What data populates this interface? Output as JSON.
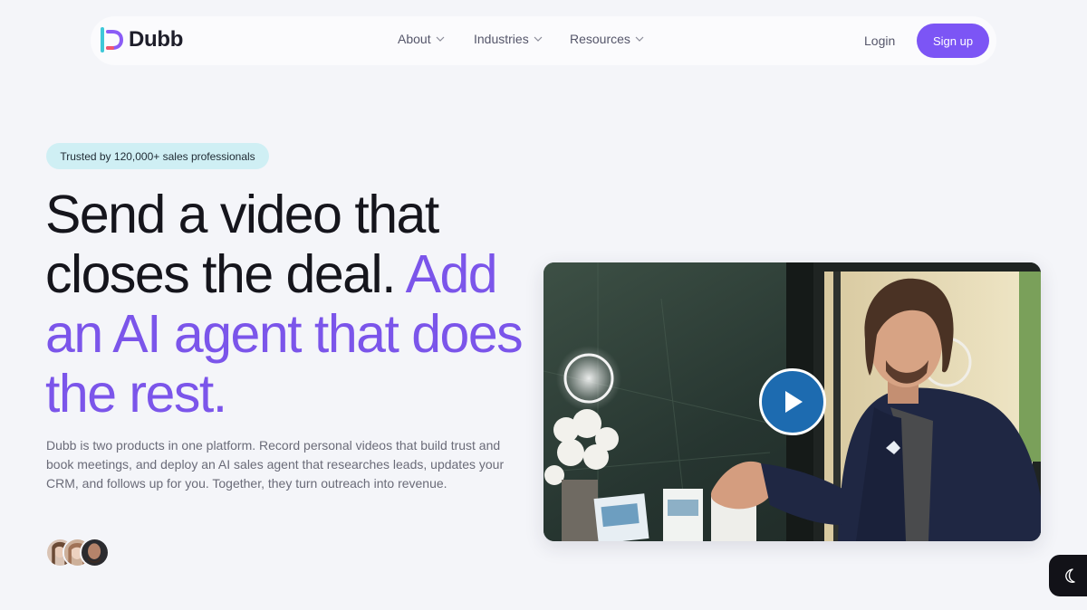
{
  "brand": {
    "name": "Dubb"
  },
  "nav": {
    "links": [
      {
        "label": "About"
      },
      {
        "label": "Industries"
      },
      {
        "label": "Resources"
      }
    ],
    "login_label": "Login",
    "signup_label": "Sign up"
  },
  "hero": {
    "badge": "Trusted by 120,000+ sales professionals",
    "headline_part1": "Send a video that closes the deal.",
    "headline_part2": "Add an AI agent that does the rest.",
    "subtext": "Dubb is two products in one platform. Record personal videos that build trust and book meetings, and deploy an AI sales agent that researches leads, updates your CRM, and follows up for you. Together, they turn outreach into revenue."
  },
  "icons": {
    "chevron": "chevron-down-icon",
    "play": "play-icon",
    "theme": "moon-icon"
  },
  "colors": {
    "accent": "#7b55ea",
    "signup_bg": "#7c55f5",
    "badge_bg": "#cfeff4",
    "play_bg": "#1d6bb0",
    "background": "#f4f5f9"
  }
}
